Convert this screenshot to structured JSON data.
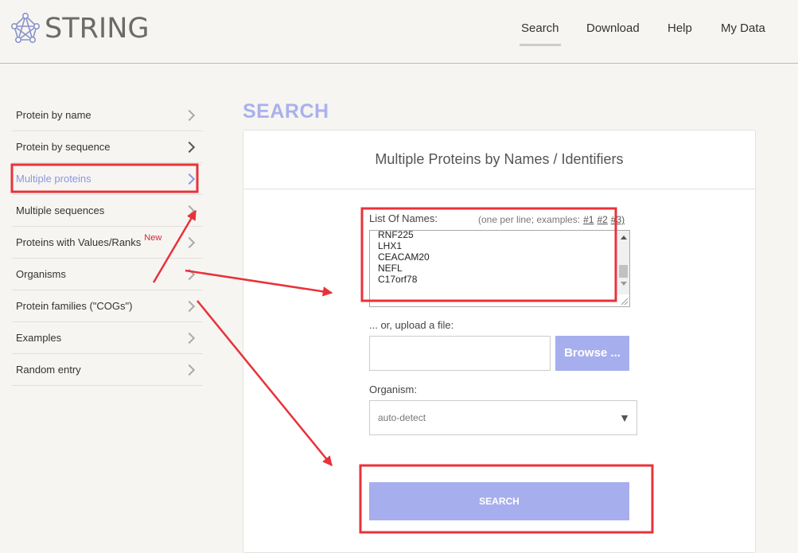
{
  "header": {
    "logo_text": "STRING",
    "nav": [
      "Search",
      "Download",
      "Help",
      "My Data"
    ]
  },
  "sidebar": {
    "items": [
      {
        "label": "Protein by name"
      },
      {
        "label": "Protein by sequence"
      },
      {
        "label": "Multiple proteins"
      },
      {
        "label": "Multiple sequences"
      },
      {
        "label": "Proteins with Values/Ranks",
        "badge": "New"
      },
      {
        "label": "Organisms"
      },
      {
        "label": "Protein families (\"COGs\")"
      },
      {
        "label": "Examples"
      },
      {
        "label": "Random entry"
      }
    ]
  },
  "main": {
    "title": "SEARCH",
    "card_title": "Multiple Proteins by Names / Identifiers",
    "names_label": "List Of Names:",
    "names_hint": "(one per line; examples:",
    "examples": [
      "#1",
      "#2",
      "#3)"
    ],
    "names": [
      "RNF225",
      "LHX1",
      "CEACAM20",
      "NEFL",
      "C17orf78"
    ],
    "upload_label": "... or, upload a file:",
    "browse_label": "Browse ...",
    "organism_label": "Organism:",
    "organism_value": "auto-detect",
    "search_button": "SEARCH"
  },
  "colors": {
    "accent": "#a7aeed",
    "active_link": "#8c96e0",
    "annotation": "#e8323a"
  }
}
